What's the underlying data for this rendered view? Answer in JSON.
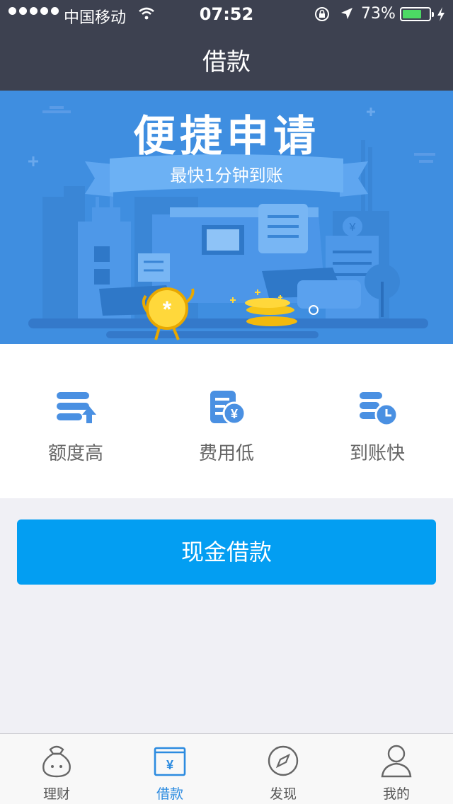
{
  "status_bar": {
    "carrier": "中国移动",
    "time": "07:52",
    "battery_percent": "73%",
    "battery_level": 0.73
  },
  "nav": {
    "title": "借款"
  },
  "banner": {
    "title": "便捷申请",
    "subtitle": "最快1分钟到账"
  },
  "features": [
    {
      "label": "额度高",
      "icon": "stack-arrow-up-icon"
    },
    {
      "label": "费用低",
      "icon": "document-yen-icon"
    },
    {
      "label": "到账快",
      "icon": "stack-clock-icon"
    }
  ],
  "primary_button": {
    "label": "现金借款"
  },
  "tabbar": {
    "items": [
      {
        "label": "理财",
        "icon": "money-bag-icon",
        "active": false
      },
      {
        "label": "借款",
        "icon": "wallet-yen-icon",
        "active": true
      },
      {
        "label": "发现",
        "icon": "compass-icon",
        "active": false
      },
      {
        "label": "我的",
        "icon": "person-icon",
        "active": false
      }
    ]
  },
  "colors": {
    "header_bg": "#3d4150",
    "banner_bg": "#3f8ee0",
    "accent": "#039ef2",
    "tab_active": "#2c8be0",
    "battery_fill": "#4cd964"
  }
}
